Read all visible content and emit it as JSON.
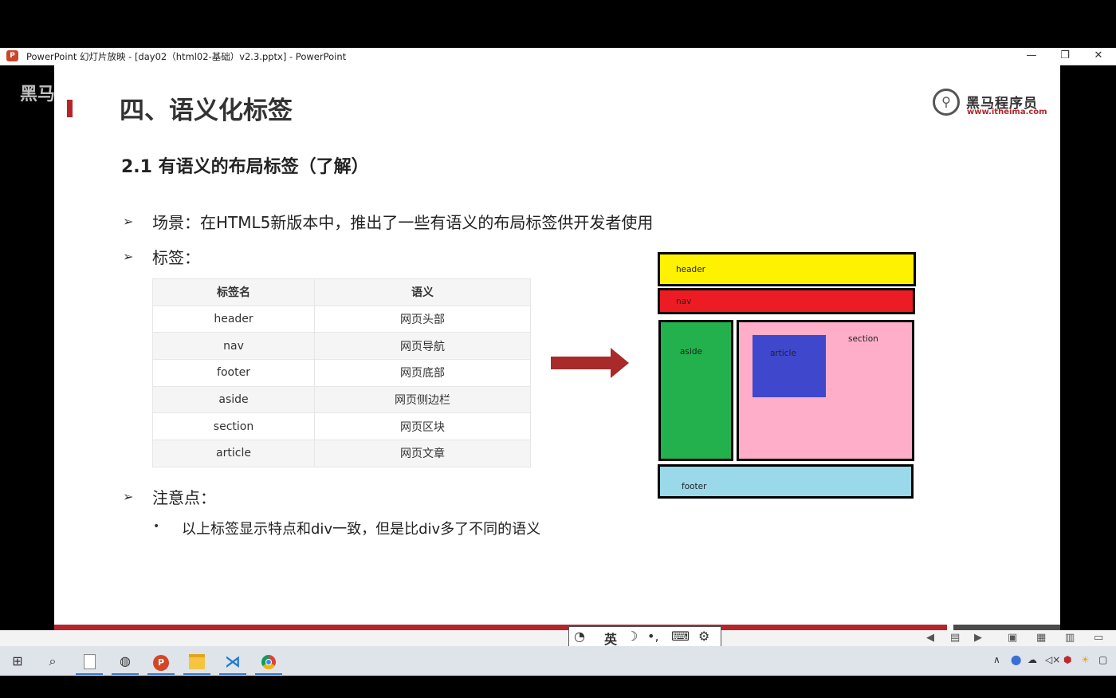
{
  "window": {
    "app_icon": "P",
    "title": "PowerPoint 幻灯片放映 - [day02（html02-基础）v2.3.pptx] - PowerPoint",
    "minimize": "—",
    "restore": "❐",
    "close": "✕"
  },
  "watermark": "黑马",
  "slide": {
    "title": "四、语义化标签",
    "subtitle": "2.1 有语义的布局标签（了解）",
    "logo": {
      "name": "黑马程序员",
      "url": "www.itheima.com"
    },
    "bullets": [
      {
        "marker": "➢",
        "text": "场景：在HTML5新版本中，推出了一些有语义的布局标签供开发者使用"
      },
      {
        "marker": "➢",
        "text": "标签："
      },
      {
        "marker": "➢",
        "text": "注意点："
      }
    ],
    "sub_bullet": {
      "marker": "•",
      "text": "以上标签显示特点和div一致，但是比div多了不同的语义"
    },
    "table": {
      "headers": [
        "标签名",
        "语义"
      ],
      "rows": [
        [
          "header",
          "网页头部"
        ],
        [
          "nav",
          "网页导航"
        ],
        [
          "footer",
          "网页底部"
        ],
        [
          "aside",
          "网页侧边栏"
        ],
        [
          "section",
          "网页区块"
        ],
        [
          "article",
          "网页文章"
        ]
      ]
    },
    "diagram": {
      "header": "header",
      "nav": "nav",
      "aside": "aside",
      "section": "section",
      "article": "article",
      "footer": "footer",
      "colors": {
        "header": "#fff200",
        "nav": "#ed1c24",
        "aside": "#22b14c",
        "section": "#ffaec9",
        "article": "#3f48cc",
        "footer": "#99d9ea"
      }
    }
  },
  "ime": {
    "char": "英",
    "moon": "☽",
    "punct": "•,",
    "keyboard": "⌨",
    "settings": "⚙"
  },
  "taskbar": {
    "start": "⊞",
    "search": "⌕",
    "tray_chevron": "∧",
    "volume": "🔇"
  }
}
